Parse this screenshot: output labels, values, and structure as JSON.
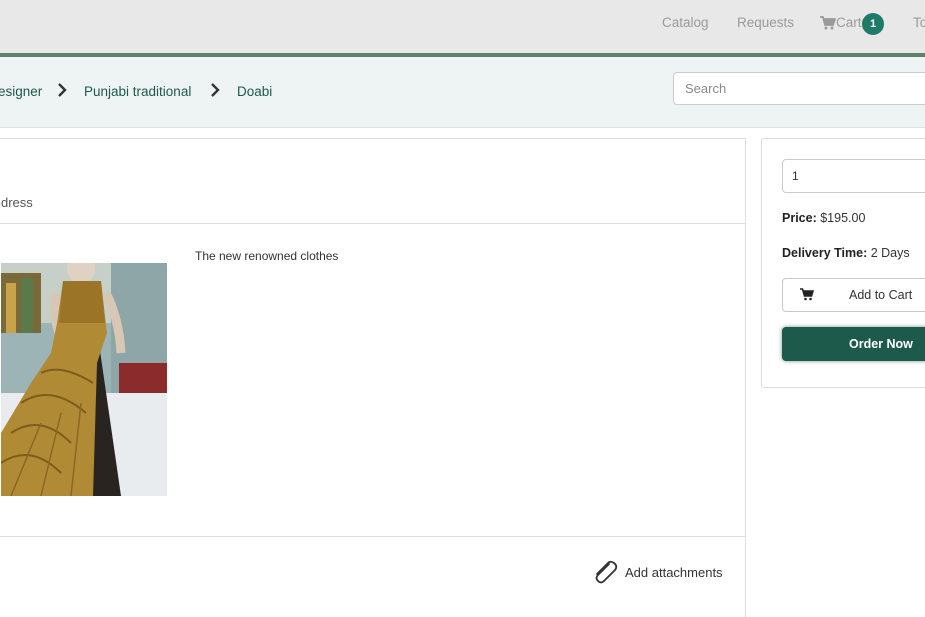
{
  "nav": {
    "items": [
      {
        "label": "Catalog"
      },
      {
        "label": "Requests"
      },
      {
        "label": "Cart"
      },
      {
        "label": "To"
      }
    ],
    "cart_count": "1",
    "cart_icon": "shopping-cart-icon"
  },
  "breadcrumb": {
    "items": [
      {
        "label": "esigner"
      },
      {
        "label": "Punjabi traditional"
      },
      {
        "label": "Doabi"
      }
    ],
    "separator_icon": "chevron-right-icon"
  },
  "search": {
    "placeholder": "Search"
  },
  "product": {
    "subtitle": "dress",
    "description": "The new renowned clothes",
    "image_icon": "product-photo"
  },
  "attachments": {
    "label": "Add attachments",
    "icon": "paperclip-icon"
  },
  "order": {
    "quantity": "1",
    "price_label": "Price:",
    "price_value": "$195.00",
    "delivery_label": "Delivery Time:",
    "delivery_value": "2 Days",
    "add_to_cart_label": "Add to Cart",
    "order_now_label": "Order Now"
  },
  "colors": {
    "brand": "#1d5a4c",
    "badge": "#1e7b68",
    "nav_accent_line": "#5d806f"
  }
}
